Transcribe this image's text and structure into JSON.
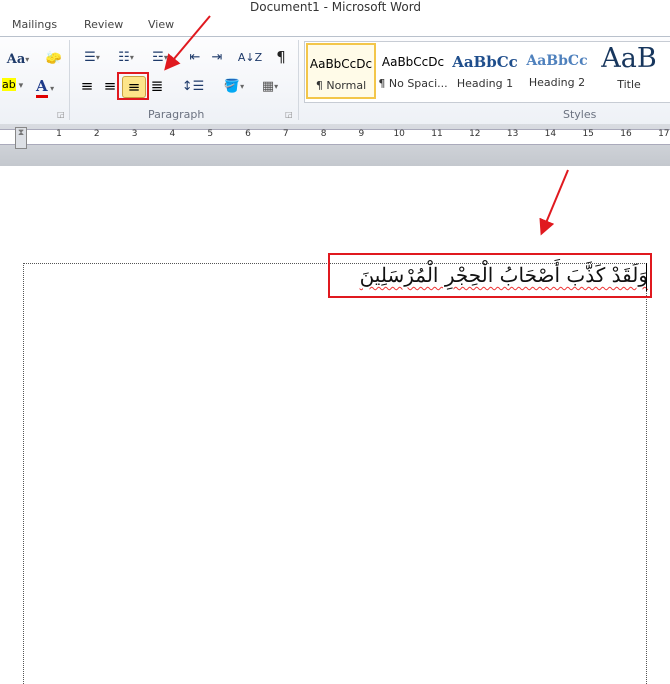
{
  "window": {
    "title": "Document1 - Microsoft Word"
  },
  "tabs": [
    {
      "label": "Mailings"
    },
    {
      "label": "Review"
    },
    {
      "label": "View"
    }
  ],
  "ribbon": {
    "font_group": {
      "change_case_label": "Aa",
      "highlight_label": "ab",
      "font_color_label": "A",
      "highlight_color": "#ffff00",
      "font_color": "#e00000"
    },
    "paragraph_group": {
      "label": "Paragraph",
      "active_button": "align-right",
      "show_marks_label": "¶",
      "sort_label": "A↓Z"
    },
    "styles_group": {
      "label": "Styles",
      "items": [
        {
          "preview": "AaBbCcDc",
          "label": "¶ Normal",
          "selected": true
        },
        {
          "preview": "AaBbCcDc",
          "label": "¶ No Spaci..."
        },
        {
          "preview": "AaBbCc",
          "label": "Heading 1"
        },
        {
          "preview": "AaBbCc",
          "label": "Heading 2"
        },
        {
          "preview": "AaB",
          "label": "Title"
        }
      ]
    }
  },
  "ruler": {
    "numbers": [
      "1",
      "2",
      "3",
      "4",
      "5",
      "6",
      "7",
      "8",
      "9",
      "10",
      "11",
      "12",
      "13",
      "14",
      "15",
      "16",
      "17"
    ]
  },
  "document": {
    "text": "وَلَقَدْ كَذَّبَ أَصْحَابُ الْحِجْرِ الْمُرْسَلِينَ",
    "alignment": "right"
  },
  "annotation_color": "#e0191f"
}
